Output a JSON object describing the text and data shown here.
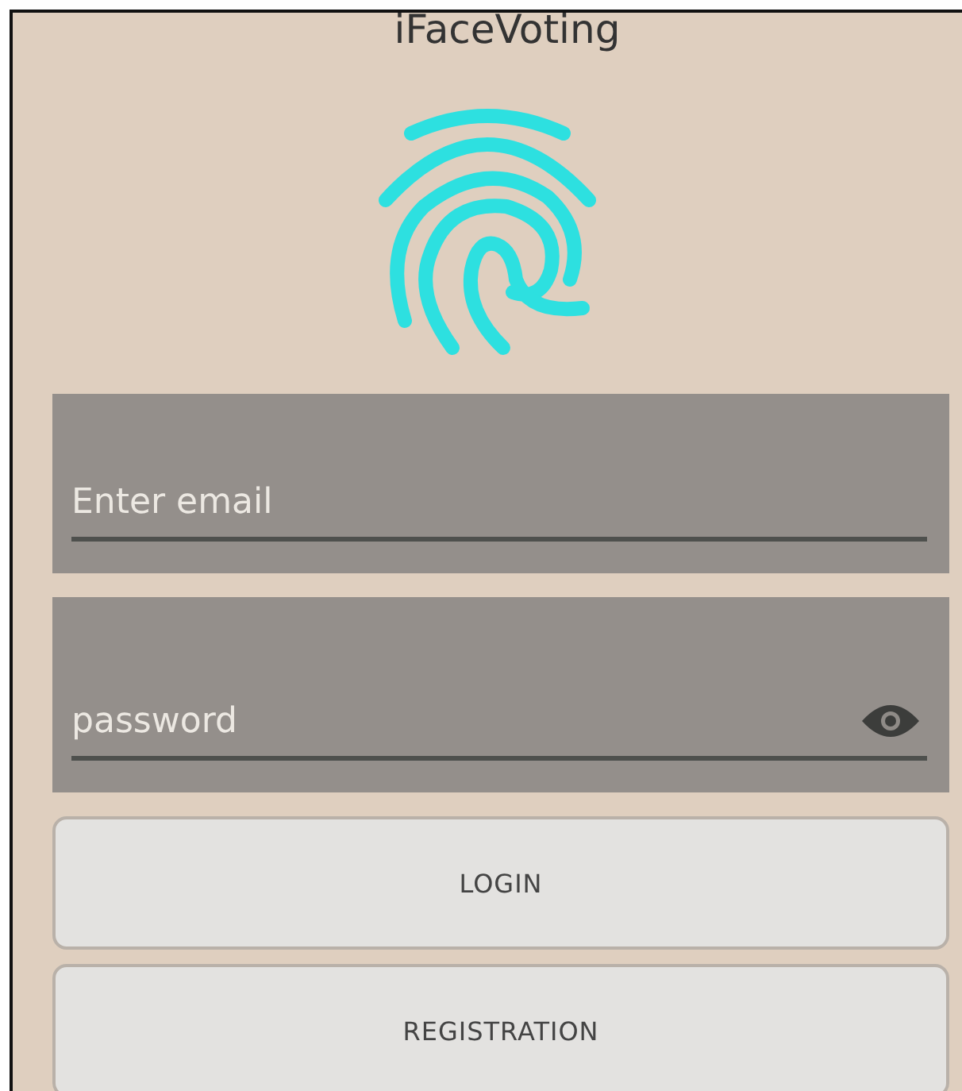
{
  "app_title": "iFaceVoting",
  "fields": [
    {
      "kind": "email",
      "placeholder": "Enter email"
    },
    {
      "kind": "password",
      "placeholder": "password"
    }
  ],
  "buttons": [
    "LOGIN",
    "REGISTRATION"
  ]
}
